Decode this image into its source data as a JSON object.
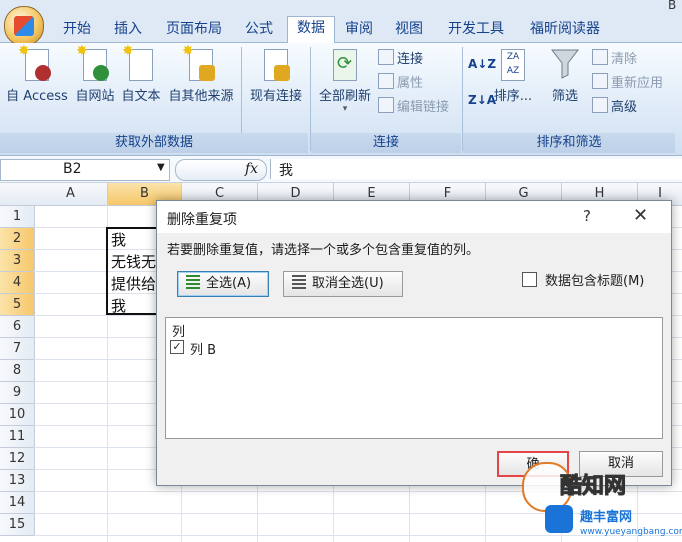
{
  "window": {
    "title_fragment": "B"
  },
  "tabs": [
    {
      "label": "开始"
    },
    {
      "label": "插入"
    },
    {
      "label": "页面布局"
    },
    {
      "label": "公式"
    },
    {
      "label": "数据"
    },
    {
      "label": "审阅"
    },
    {
      "label": "视图"
    },
    {
      "label": "开发工具"
    },
    {
      "label": "福昕阅读器"
    }
  ],
  "ribbon": {
    "external": {
      "label": "获取外部数据",
      "buttons": [
        {
          "label": "自 Access"
        },
        {
          "label": "自网站"
        },
        {
          "label": "自文本"
        },
        {
          "label": "自其他来源"
        }
      ],
      "existing": "现有连接"
    },
    "connections": {
      "label": "连接",
      "refresh": "全部刷新",
      "items": [
        {
          "label": "连接"
        },
        {
          "label": "属性"
        },
        {
          "label": "编辑链接"
        }
      ]
    },
    "sort_filter": {
      "label": "排序和筛选",
      "sort": "排序...",
      "filter": "筛选",
      "items": [
        {
          "label": "清除"
        },
        {
          "label": "重新应用"
        },
        {
          "label": "高级"
        }
      ]
    }
  },
  "formula_bar": {
    "name_box": "B2",
    "fx": "fx",
    "content": "我"
  },
  "grid": {
    "columns": [
      "A",
      "B",
      "C",
      "D",
      "E",
      "F",
      "G",
      "H",
      "I"
    ],
    "selected_column": "B",
    "rows": [
      "1",
      "2",
      "3",
      "4",
      "5",
      "6",
      "7",
      "8",
      "9",
      "10",
      "11",
      "12",
      "13",
      "14",
      "15"
    ],
    "cells_b": [
      "我",
      "无钱无",
      "提供给",
      "我"
    ]
  },
  "dialog": {
    "title": "删除重复项",
    "help": "?",
    "close": "✕",
    "instruction": "若要删除重复值，请选择一个或多个包含重复值的列。",
    "select_all": "全选(A)",
    "unselect_all": "取消全选(U)",
    "header_checkbox": "数据包含标题(M)",
    "list_header": "列",
    "list_items": [
      {
        "label": "列 B",
        "checked": true
      }
    ],
    "ok": "确",
    "cancel": "取消"
  },
  "watermark": {
    "title": "酷知网",
    "subtitle": "趣丰富网",
    "url": "www.yueyangbang.com"
  },
  "colors": {
    "ribbon_text": "#15428b",
    "selected_header": "#f6c76a",
    "ok_highlight": "#e64545"
  }
}
